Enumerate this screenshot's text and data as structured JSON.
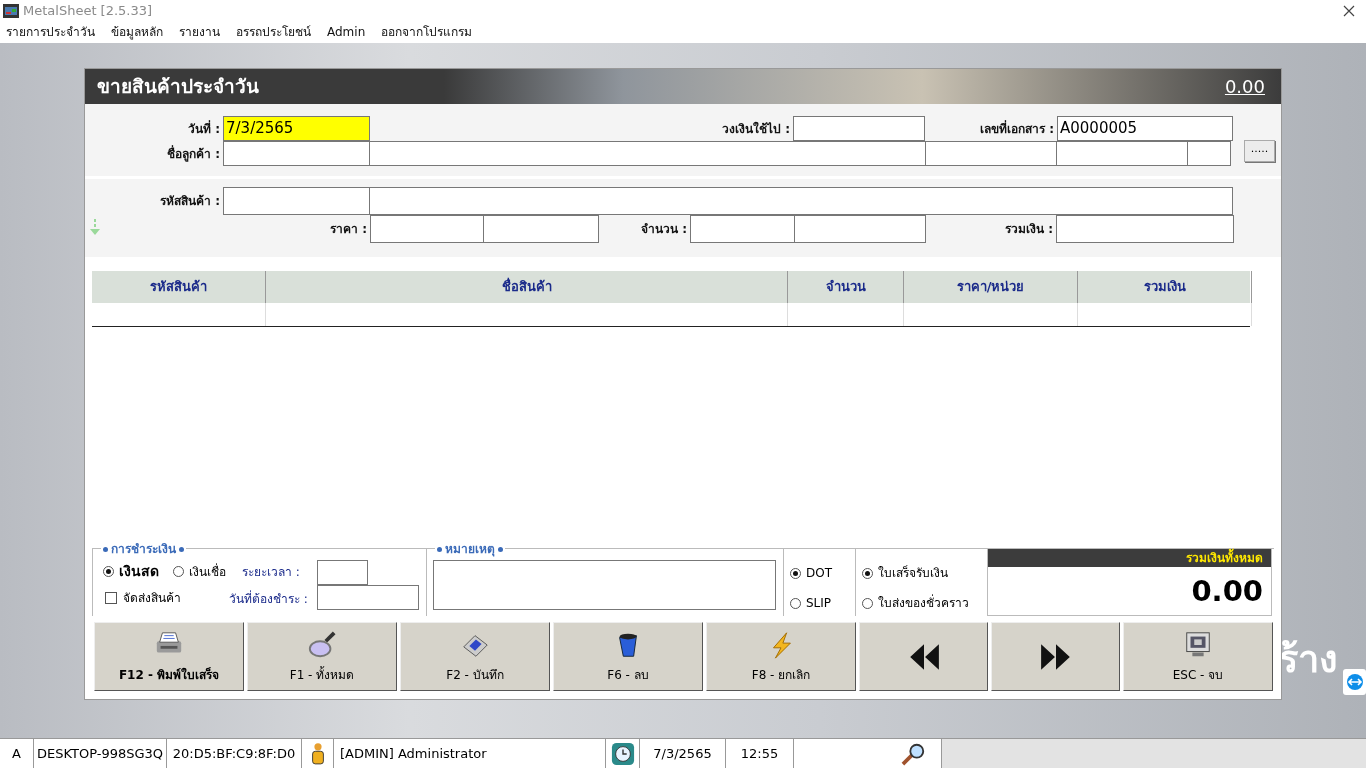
{
  "window": {
    "title": "MetalSheet [2.5.33]"
  },
  "menu": [
    "รายการประจำวัน",
    "ข้อมูลหลัก",
    "รายงาน",
    "อรรถประโยชน์",
    "Admin",
    "ออกจากโปรแกรม"
  ],
  "background_text": "ร้าง",
  "form": {
    "title": "ขายสินค้าประจำวัน",
    "header_total": "0.00",
    "date": {
      "label": "วันที่ :",
      "value": "7/3/2565"
    },
    "credit_used": {
      "label": "วงเงินใช้ไป :"
    },
    "document_no": {
      "label": "เลขที่เอกสาร :",
      "value": "A0000005"
    },
    "customer": {
      "label": "ชื่อลูกค้า :"
    },
    "lookup_button": ".....",
    "product_code": {
      "label": "รหัสสินค้า :"
    },
    "price": {
      "label": "ราคา :"
    },
    "quantity": {
      "label": "จำนวน :"
    },
    "amount": {
      "label": "รวมเงิน :"
    },
    "table": {
      "columns": [
        "รหัสสินค้า",
        "ชื่อสินค้า",
        "จำนวน",
        "ราคา/หน่วย",
        "รวมเงิน"
      ]
    },
    "payment": {
      "title": "การชำระเงิน",
      "options": [
        {
          "label": "เงินสด",
          "selected": true
        },
        {
          "label": "เงินเชื่อ",
          "selected": false
        }
      ],
      "delivery": {
        "label": "จัดส่งสินค้า",
        "checked": false
      },
      "term_label": "ระยะเวลา :",
      "due_label": "วันที่ต้องชำระ :"
    },
    "remarks": {
      "title": "หมายเหตุ"
    },
    "printer": [
      {
        "label": "DOT",
        "selected": true
      },
      {
        "label": "SLIP",
        "selected": false
      }
    ],
    "document_type": [
      {
        "label": "ใบเสร็จรับเงิน",
        "selected": true
      },
      {
        "label": "ใบส่งของชั่วคราว",
        "selected": false
      }
    ],
    "grand_total": {
      "label": "รวมเงินทั้งหมด",
      "value": "0.00"
    },
    "buttons": [
      {
        "kind": "print",
        "label": "F12 - พิมพ์ใบเสร็จ",
        "default": true
      },
      {
        "kind": "search",
        "label": "F1 - ทั้งหมด",
        "default": false
      },
      {
        "kind": "save",
        "label": "F2 - บันทึก",
        "default": false
      },
      {
        "kind": "delete",
        "label": "F6 - ลบ",
        "default": false
      },
      {
        "kind": "cancel",
        "label": "F8 - ยกเลิก",
        "default": false
      },
      {
        "kind": "previous"
      },
      {
        "kind": "next"
      },
      {
        "kind": "exit",
        "label": "ESC - จบ",
        "default": false
      }
    ]
  },
  "status_bar": [
    {
      "kind": "text",
      "text": "A"
    },
    {
      "kind": "text",
      "text": "DESKTOP-998SG3Q"
    },
    {
      "kind": "text",
      "text": "20:D5:BF:C9:8F:D0"
    },
    {
      "kind": "user"
    },
    {
      "kind": "text",
      "text": "[ADMIN] Administrator"
    },
    {
      "kind": "clock"
    },
    {
      "kind": "text",
      "text": "7/3/2565"
    },
    {
      "kind": "text",
      "text": "12:55"
    },
    {
      "kind": "search"
    }
  ]
}
